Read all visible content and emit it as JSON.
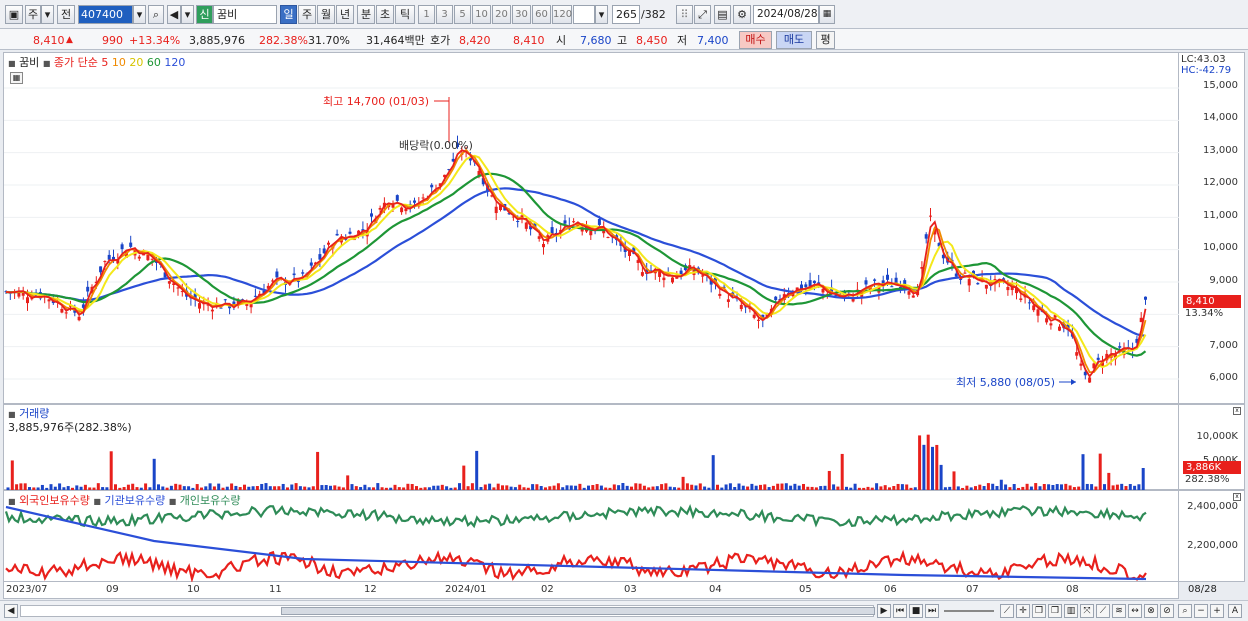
{
  "toolbar": {
    "period_week": "주",
    "prev": "전",
    "code": "407400",
    "new_badge": "신",
    "stock_name": "꿈비",
    "periods": [
      "일",
      "주",
      "월",
      "년",
      "분",
      "초",
      "틱"
    ],
    "numbers": [
      "1",
      "3",
      "5",
      "10",
      "20",
      "30",
      "60",
      "120"
    ],
    "count_display": "265",
    "count_total": "/382",
    "date": "2024/08/28"
  },
  "quote": {
    "price": "8,410",
    "change": "990",
    "change_pct": "+13.34%",
    "volume": "3,885,976",
    "volume_ratio": "282.38%",
    "turnover": "31.70%",
    "amount": "31,464백만",
    "bid_label": "호가",
    "ask_price": "8,420",
    "bid_price": "8,410",
    "open_label": "시",
    "open": "7,680",
    "high_label": "고",
    "high": "8,450",
    "low_label": "저",
    "low": "7,400",
    "buy_button": "매수",
    "sell_button": "매도",
    "eval_button": "평"
  },
  "price_panel": {
    "stock_tag": "꿈비",
    "ma_label": "종가 단순",
    "ma_periods": [
      "5",
      "10",
      "20",
      "60",
      "120"
    ],
    "lc": "LC:43.03",
    "hc": "HC:-42.79",
    "y_ticks": [
      "15,000",
      "14,000",
      "13,000",
      "12,000",
      "11,000",
      "10,000",
      "9,000",
      "8,000",
      "7,000",
      "6,000"
    ],
    "current_price_tag": "8,410",
    "current_pct_tag": "13.34%",
    "high_annotation": "최고 14,700 (01/03)",
    "low_annotation": "최저 5,880 (08/05)",
    "dividend_annotation": "배당락(0.00%)"
  },
  "volume_panel": {
    "title": "거래량",
    "value": "3,885,976주(282.38%)",
    "y_ticks": [
      "10,000K",
      "5,000K"
    ],
    "current_tag": "3,886K",
    "current_pct": "282.38%"
  },
  "holding_panel": {
    "foreign": "외국인보유수량",
    "institution": "기관보유수량",
    "individual": "개인보유수량",
    "y_ticks": [
      "2,400,000",
      "2,200,000"
    ]
  },
  "x_axis": {
    "labels": [
      "2023/07",
      "09",
      "10",
      "11",
      "12",
      "2024/01",
      "02",
      "03",
      "04",
      "05",
      "06",
      "07",
      "08"
    ],
    "right_label": "08/28"
  },
  "colors": {
    "candle_up": "#e8201c",
    "candle_down": "#1a45c8",
    "ma5": "#e8201c",
    "ma10": "#f08a00",
    "ma20": "#f4e81a",
    "ma60": "#1e9636",
    "ma120": "#2b4fd8",
    "foreign_line": "#e8201c",
    "institution_line": "#2b4fd8",
    "individual_line": "#2e8b57"
  }
}
